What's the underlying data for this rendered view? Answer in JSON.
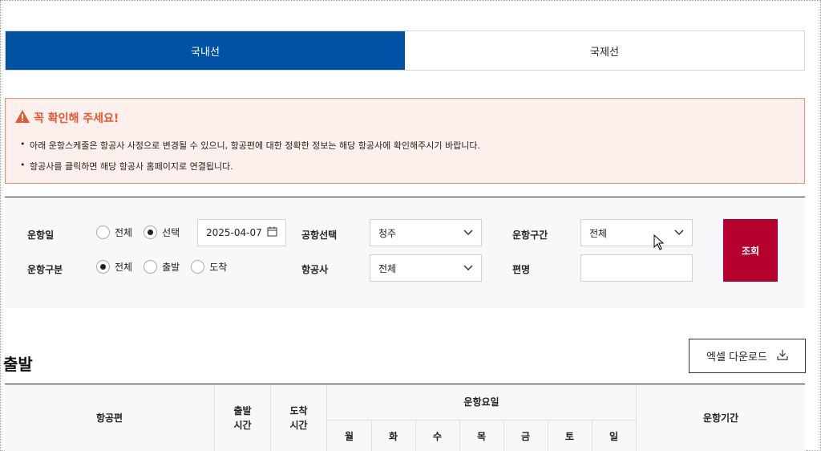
{
  "tabs": {
    "domestic": "국내선",
    "international": "국제선"
  },
  "notice": {
    "title": "꼭 확인해 주세요!",
    "items": [
      "아래 운항스케줄은 항공사 사정으로 변경될 수 있으니, 항공편에 대한 정확한 정보는 해당 항공사에 확인해주시기 바랍니다.",
      "항공사를 클릭하면 해당 항공사 홈페이지로 연결됩니다."
    ]
  },
  "search": {
    "date_label": "운항일",
    "date_options": [
      "전체",
      "선택"
    ],
    "date_selected": "선택",
    "date_value": "2025-04-07",
    "airport_label": "공항선택",
    "airport_value": "청주",
    "route_label": "운항구간",
    "route_value": "전체",
    "type_label": "운항구분",
    "type_options": [
      "전체",
      "출발",
      "도착"
    ],
    "type_selected": "전체",
    "airline_label": "항공사",
    "airline_value": "전체",
    "flight_label": "편명",
    "flight_value": "",
    "submit_label": "조회"
  },
  "section": {
    "title": "출발",
    "excel_label": "엑셀 다운로드"
  },
  "table": {
    "col_flight": "항공편",
    "col_dep": "출발\n시간",
    "col_arr": "도착\n시간",
    "col_days": "운항요일",
    "days": [
      "월",
      "화",
      "수",
      "목",
      "금",
      "토",
      "일"
    ],
    "col_period": "운항기간"
  },
  "colors": {
    "tab_active": "#0052a4",
    "notice_accent": "#e8572e",
    "submit": "#b5002d"
  }
}
